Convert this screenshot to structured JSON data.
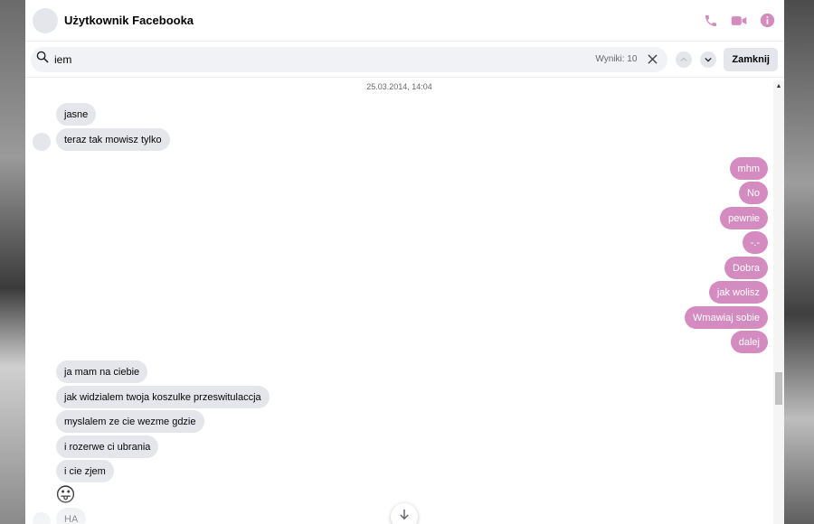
{
  "header": {
    "title": "Użytkownik Facebooka",
    "icons": [
      "phone-icon",
      "video-camera-icon",
      "info-icon"
    ],
    "accent_color": "#d48bbf"
  },
  "search": {
    "value": "iem",
    "results_label": "Wyniki: 10",
    "close_label": "Zamknij"
  },
  "conversation": {
    "timestamp": "25.03.2014, 14:04",
    "incoming_group_1": [
      "jasne",
      "teraz tak mowisz tylko"
    ],
    "outgoing": [
      "mhm",
      "No",
      "pewnie",
      "-.-",
      "Dobra",
      "jak wolisz",
      "Wmawiaj sobie",
      "dalej"
    ],
    "incoming_group_2": [
      "ja mam na ciebie",
      "jak widzialem twoja koszulke przeswitulaccja",
      "myslalem ze cie wezme gdzie",
      "i rozerwe ci ubrania",
      "i cie zjem"
    ],
    "emoji": "😛",
    "last_message": "HA"
  }
}
